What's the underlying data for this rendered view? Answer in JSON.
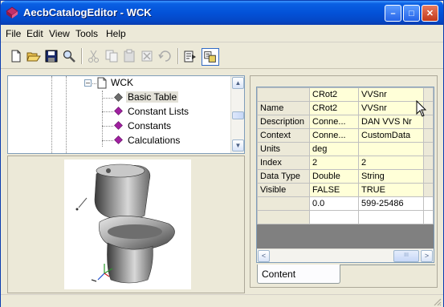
{
  "window": {
    "title": "AecbCatalogEditor - WCK",
    "controls": {
      "minimize": "–",
      "maximize": "□",
      "close": "✕"
    }
  },
  "menu": [
    "File",
    "Edit",
    "View",
    "Tools",
    "Help"
  ],
  "toolbar": {
    "icons": [
      "new-icon",
      "open-icon",
      "save-icon",
      "find-icon",
      "cut-icon",
      "copy-icon",
      "paste-icon",
      "delete-icon",
      "undo-icon",
      "properties-icon",
      "toggle-view-icon"
    ]
  },
  "tree": {
    "root": "WCK",
    "children": [
      "Basic Table",
      "Constant Lists",
      "Constants",
      "Calculations"
    ],
    "selected": "Basic Table"
  },
  "grid": {
    "columns": [
      "CRot2",
      "VVSnr"
    ],
    "rows": [
      {
        "label": "Name",
        "a": "CRot2",
        "b": "VVSnr"
      },
      {
        "label": "Description",
        "a": "Conne...",
        "b": "DAN VVS Nr"
      },
      {
        "label": "Context",
        "a": "Conne...",
        "b": "CustomData"
      },
      {
        "label": "Units",
        "a": "deg",
        "b": ""
      },
      {
        "label": "Index",
        "a": "2",
        "b": "2"
      },
      {
        "label": "Data Type",
        "a": "Double",
        "b": "String"
      },
      {
        "label": "Visible",
        "a": "FALSE",
        "b": "TRUE"
      },
      {
        "label": "",
        "a": "0.0",
        "b": "599-25486"
      }
    ],
    "tab": "Content",
    "scroll_left": "<",
    "scroll_right": ">",
    "scroll_thumb_grip": "III"
  },
  "colors": {
    "titlebar": "#0352d8",
    "cell_bg": "#ffffd8",
    "tree_diamond": "#a020a0",
    "tree_diamond_selected": "#808080"
  }
}
